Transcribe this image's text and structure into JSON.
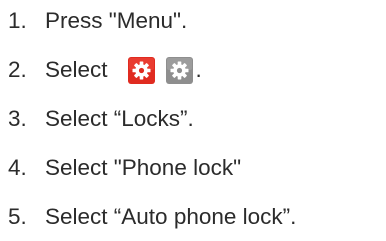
{
  "steps": [
    {
      "number": "1.",
      "text": "Press \"Menu\"."
    },
    {
      "number": "2.",
      "text": "Select",
      "trailing": ".",
      "icons": [
        "settings-gear-red-icon",
        "settings-gear-grey-icon"
      ]
    },
    {
      "number": "3.",
      "text": "Select “Locks”."
    },
    {
      "number": "4.",
      "text": "Select \"Phone lock\""
    },
    {
      "number": "5.",
      "text": "Select “Auto phone lock”."
    }
  ],
  "colors": {
    "text": "#2b2b2b",
    "icon_red_bg": "#e02b20",
    "icon_grey_bg": "#8e8e8e",
    "icon_gear": "#ffffff"
  }
}
